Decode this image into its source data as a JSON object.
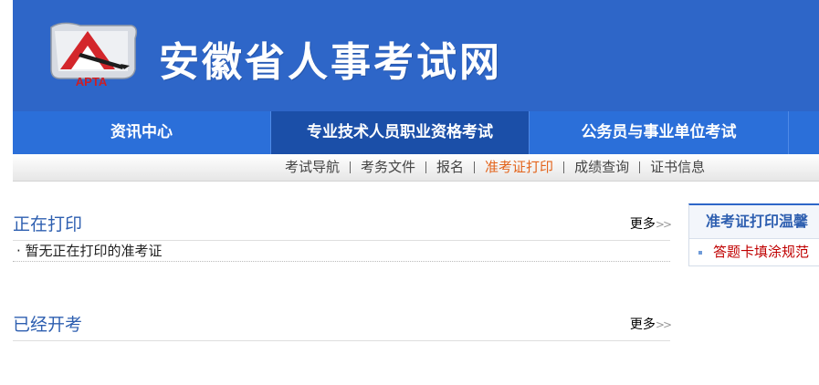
{
  "header": {
    "logo_text": "APTA",
    "site_title": "安徽省人事考试网"
  },
  "main_nav": {
    "items": [
      {
        "label": "资讯中心"
      },
      {
        "label": "专业技术人员职业资格考试"
      },
      {
        "label": "公务员与事业单位考试"
      },
      {
        "label": ""
      }
    ]
  },
  "sub_nav": {
    "items": [
      {
        "label": "考试导航"
      },
      {
        "label": "考务文件"
      },
      {
        "label": "报名"
      },
      {
        "label": "准考证打印"
      },
      {
        "label": "成绩查询"
      },
      {
        "label": "证书信息"
      }
    ],
    "active": "准考证打印"
  },
  "sections": [
    {
      "title": "正在打印",
      "more": "更多",
      "items": [
        "· 暂无正在打印的准考证"
      ]
    },
    {
      "title": "已经开考",
      "more": "更多",
      "items": []
    }
  ],
  "side_panel": {
    "title": "准考证打印温馨",
    "items": [
      {
        "label": "答题卡填涂规范"
      }
    ]
  },
  "colors": {
    "banner": "#2e66c8",
    "nav": "#2b6fd9",
    "nav_active": "#1b4fa8",
    "subnav_active": "#e3641c",
    "section_title": "#2e5fb0",
    "side_item": "#c00000"
  }
}
